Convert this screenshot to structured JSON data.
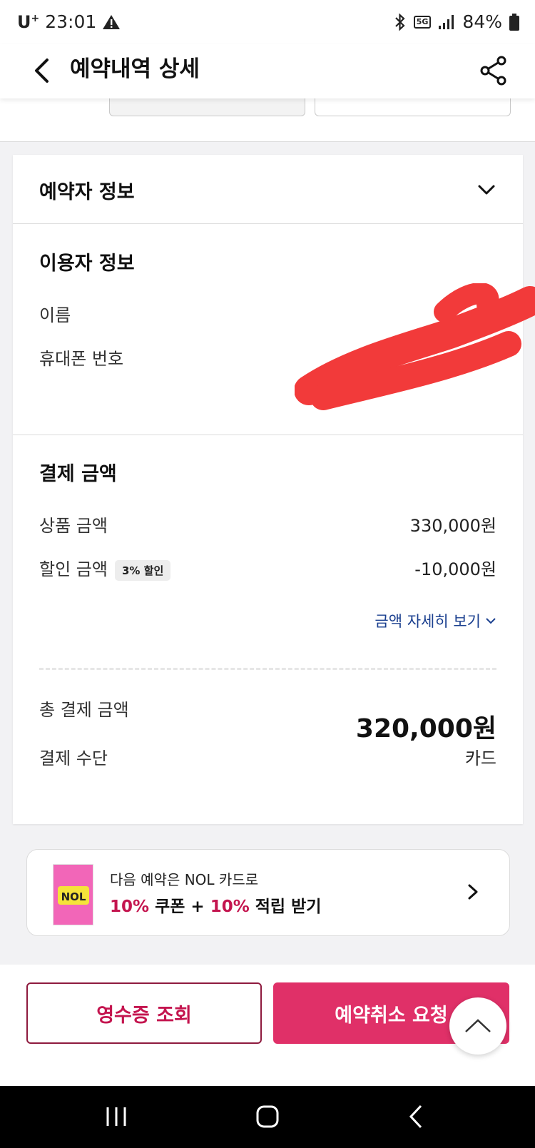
{
  "status_bar": {
    "carrier": "U",
    "carrier_sup": "+",
    "time": "23:01",
    "network": "5G",
    "battery": "84%"
  },
  "app_bar": {
    "title": "예약내역 상세",
    "back_icon": "chevron-left-icon",
    "share_icon": "share-icon"
  },
  "booker_section": {
    "title": "예약자 정보",
    "expand_icon": "chevron-down-icon"
  },
  "user_section": {
    "title": "이용자 정보",
    "name_label": "이름",
    "phone_label": "휴대폰 번호"
  },
  "payment_section": {
    "title": "결제 금액",
    "product_label": "상품 금액",
    "product_value": "330,000원",
    "discount_label": "할인 금액",
    "discount_badge": "3% 할인",
    "discount_value": "-10,000원",
    "detail_link": "금액 자세히 보기",
    "total_label": "총 결제 금액",
    "total_value": "320,000원",
    "method_label": "결제 수단",
    "method_value": "카드"
  },
  "promo": {
    "line1": "다음 예약은 NOL 카드로",
    "line2_hl1": "10%",
    "line2_mid": " 쿠폰 + ",
    "line2_hl2": "10%",
    "line2_end": " 적립 받기",
    "card_logo": "NOL"
  },
  "actions": {
    "receipt_label": "영수증 조회",
    "cancel_label": "예약취소 요청"
  },
  "colors": {
    "accent": "#e03068",
    "accent_text": "#c4154f",
    "link": "#1a3f8f"
  }
}
